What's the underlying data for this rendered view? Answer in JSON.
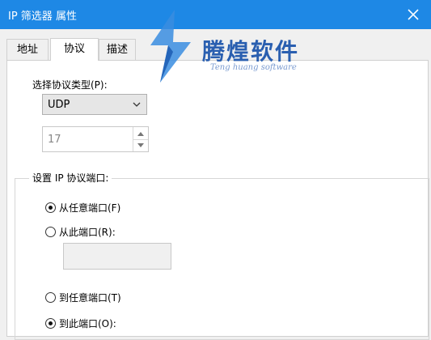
{
  "window": {
    "title": "IP 筛选器 属性",
    "close_icon": "close-icon"
  },
  "watermark": {
    "brand": "腾煌软件",
    "subtitle": "Teng huang software"
  },
  "tabs": [
    {
      "label": "地址",
      "active": false
    },
    {
      "label": "协议",
      "active": true
    },
    {
      "label": "描述",
      "active": false
    }
  ],
  "protocol": {
    "select_label": "选择协议类型(P):",
    "selected": "UDP",
    "number": "17"
  },
  "ports": {
    "group_label": "设置 IP 协议端口:",
    "from_any": {
      "label": "从任意端口(F)",
      "checked": true
    },
    "from_this": {
      "label": "从此端口(R):",
      "checked": false
    },
    "from_port_value": "",
    "to_any": {
      "label": "到任意端口(T)",
      "checked": false
    },
    "to_this": {
      "label": "到此端口(O):",
      "checked": true
    }
  }
}
